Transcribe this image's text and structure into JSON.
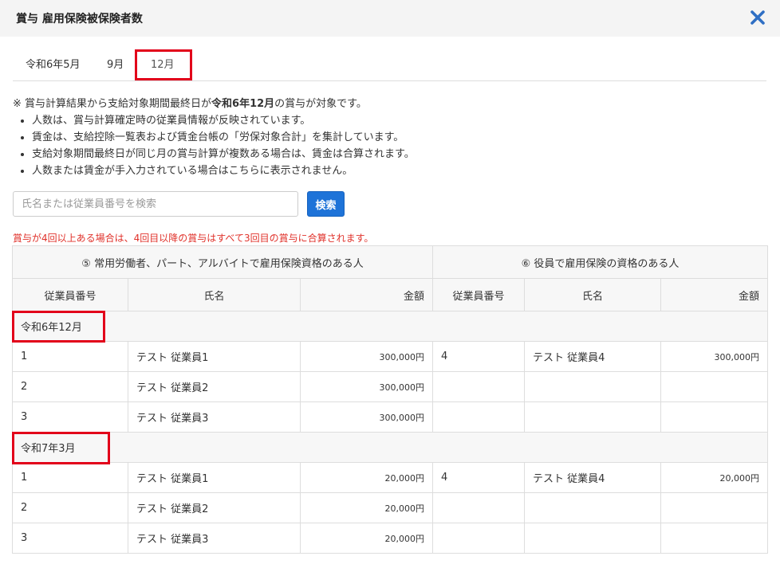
{
  "modal": {
    "title": "賞与 雇用保険被保険者数"
  },
  "tabs": [
    {
      "label": "令和6年5月"
    },
    {
      "label": "9月"
    },
    {
      "label": "12月",
      "active": true
    }
  ],
  "notes": {
    "lead_prefix": "※ 賞与計算結果から支給対象期間最終日が",
    "lead_bold": "令和6年12月",
    "lead_suffix": "の賞与が対象です。",
    "bullets": [
      "人数は、賞与計算確定時の従業員情報が反映されています。",
      "賃金は、支給控除一覧表および賃金台帳の「労保対象合計」を集計しています。",
      "支給対象期間最終日が同じ月の賞与計算が複数ある場合は、賃金は合算されます。",
      "人数または賃金が手入力されている場合はこちらに表示されません。"
    ]
  },
  "search": {
    "placeholder": "氏名または従業員番号を検索",
    "button": "検索"
  },
  "warning": "賞与が4回以上ある場合は、4回目以降の賞与はすべて3回目の賞与に合算されます。",
  "table": {
    "group_headers": [
      "⑤ 常用労働者、パート、アルバイトで雇用保険資格のある人",
      "⑥ 役員で雇用保険の資格のある人"
    ],
    "columns": [
      "従業員番号",
      "氏名",
      "金額",
      "従業員番号",
      "氏名",
      "金額"
    ],
    "sections": [
      {
        "label": "令和6年12月",
        "rows": [
          {
            "a_id": "1",
            "a_name": "テスト 従業員1",
            "a_amount": "300,000円",
            "b_id": "4",
            "b_name": "テスト 従業員4",
            "b_amount": "300,000円"
          },
          {
            "a_id": "2",
            "a_name": "テスト 従業員2",
            "a_amount": "300,000円",
            "b_id": "",
            "b_name": "",
            "b_amount": ""
          },
          {
            "a_id": "3",
            "a_name": "テスト 従業員3",
            "a_amount": "300,000円",
            "b_id": "",
            "b_name": "",
            "b_amount": ""
          }
        ]
      },
      {
        "label": "令和7年3月",
        "rows": [
          {
            "a_id": "1",
            "a_name": "テスト 従業員1",
            "a_amount": "20,000円",
            "b_id": "4",
            "b_name": "テスト 従業員4",
            "b_amount": "20,000円"
          },
          {
            "a_id": "2",
            "a_name": "テスト 従業員2",
            "a_amount": "20,000円",
            "b_id": "",
            "b_name": "",
            "b_amount": ""
          },
          {
            "a_id": "3",
            "a_name": "テスト 従業員3",
            "a_amount": "20,000円",
            "b_id": "",
            "b_name": "",
            "b_amount": ""
          }
        ]
      }
    ]
  },
  "colors": {
    "accent": "#1e73d8",
    "highlight": "#e2001a",
    "warning": "#e0322b"
  }
}
